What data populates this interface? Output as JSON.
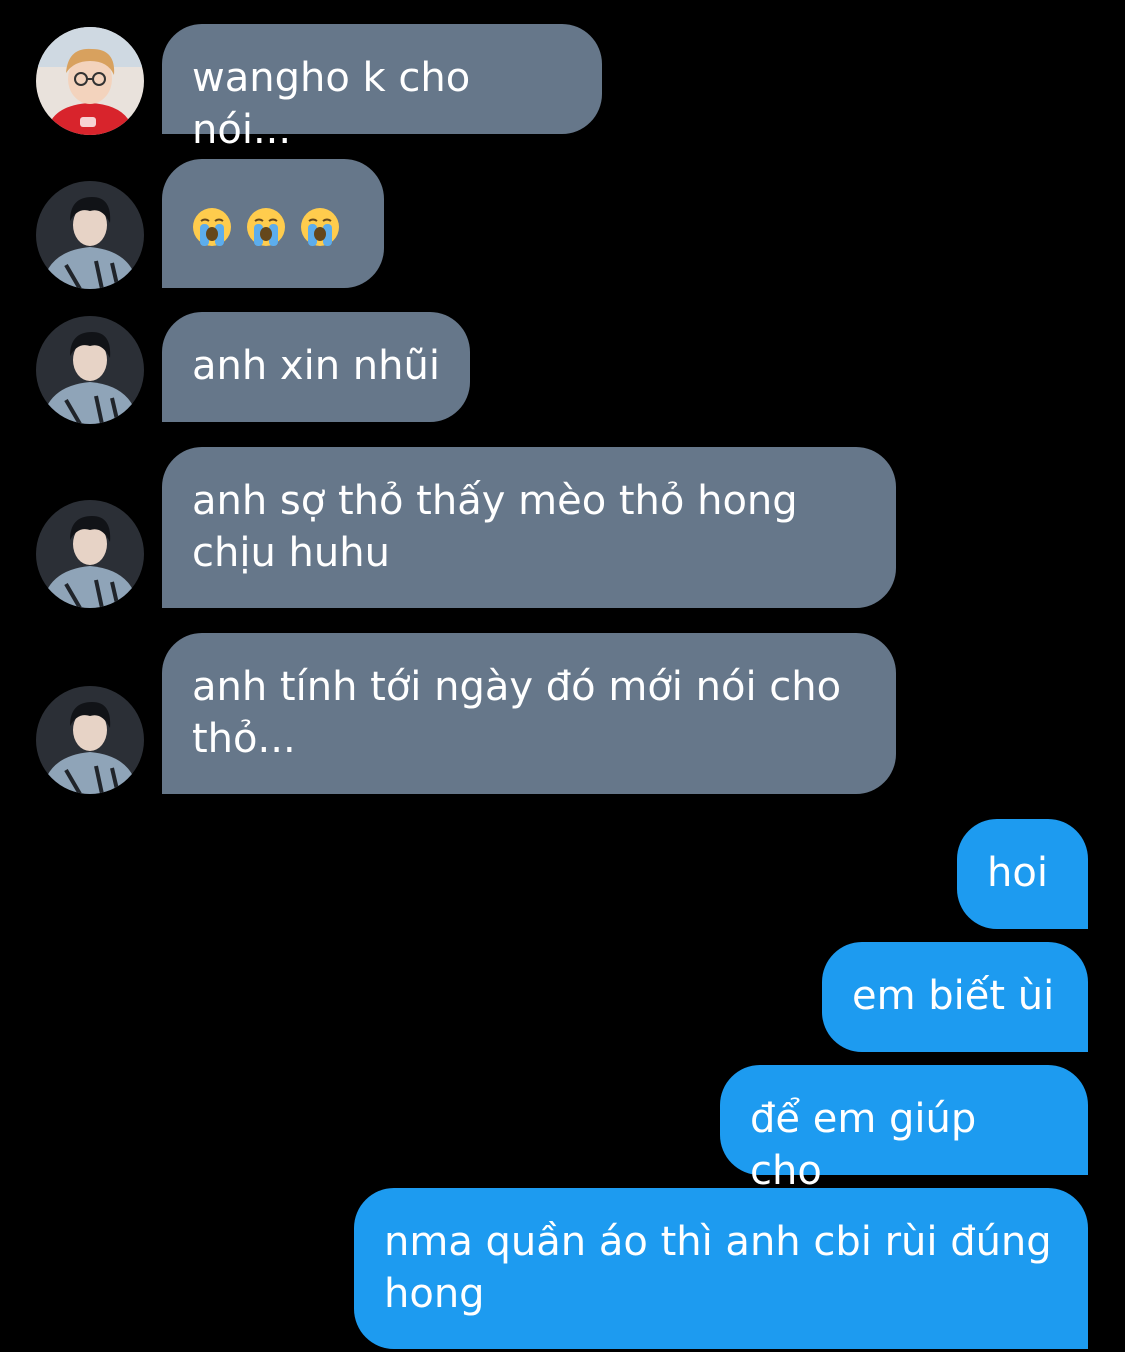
{
  "conversation": {
    "messages": [
      {
        "sender": "other",
        "avatar": "avatar-orange-hair",
        "text": "wangho k cho nói..."
      },
      {
        "sender": "other",
        "avatar": "avatar-dark-hair",
        "emoji": [
          "loudly-crying-face-emoji",
          "loudly-crying-face-emoji",
          "loudly-crying-face-emoji"
        ]
      },
      {
        "sender": "other",
        "avatar": "avatar-dark-hair",
        "text": "anh xin nhũi"
      },
      {
        "sender": "other",
        "avatar": "avatar-dark-hair",
        "text": "anh sợ thỏ thấy mèo thỏ hong chịu huhu"
      },
      {
        "sender": "other",
        "avatar": "avatar-dark-hair",
        "text": "anh tính tới ngày đó mới nói cho thỏ..."
      },
      {
        "sender": "self",
        "text": "hoi"
      },
      {
        "sender": "self",
        "text": "em biết ùi"
      },
      {
        "sender": "self",
        "text": "để em giúp cho"
      },
      {
        "sender": "self",
        "text": "nma quần áo thì anh cbi rùi đúng hong"
      }
    ]
  },
  "colors": {
    "background": "#000000",
    "incoming_bubble": "#66778a",
    "outgoing_bubble": "#1d9bf0",
    "text": "#ffffff"
  }
}
